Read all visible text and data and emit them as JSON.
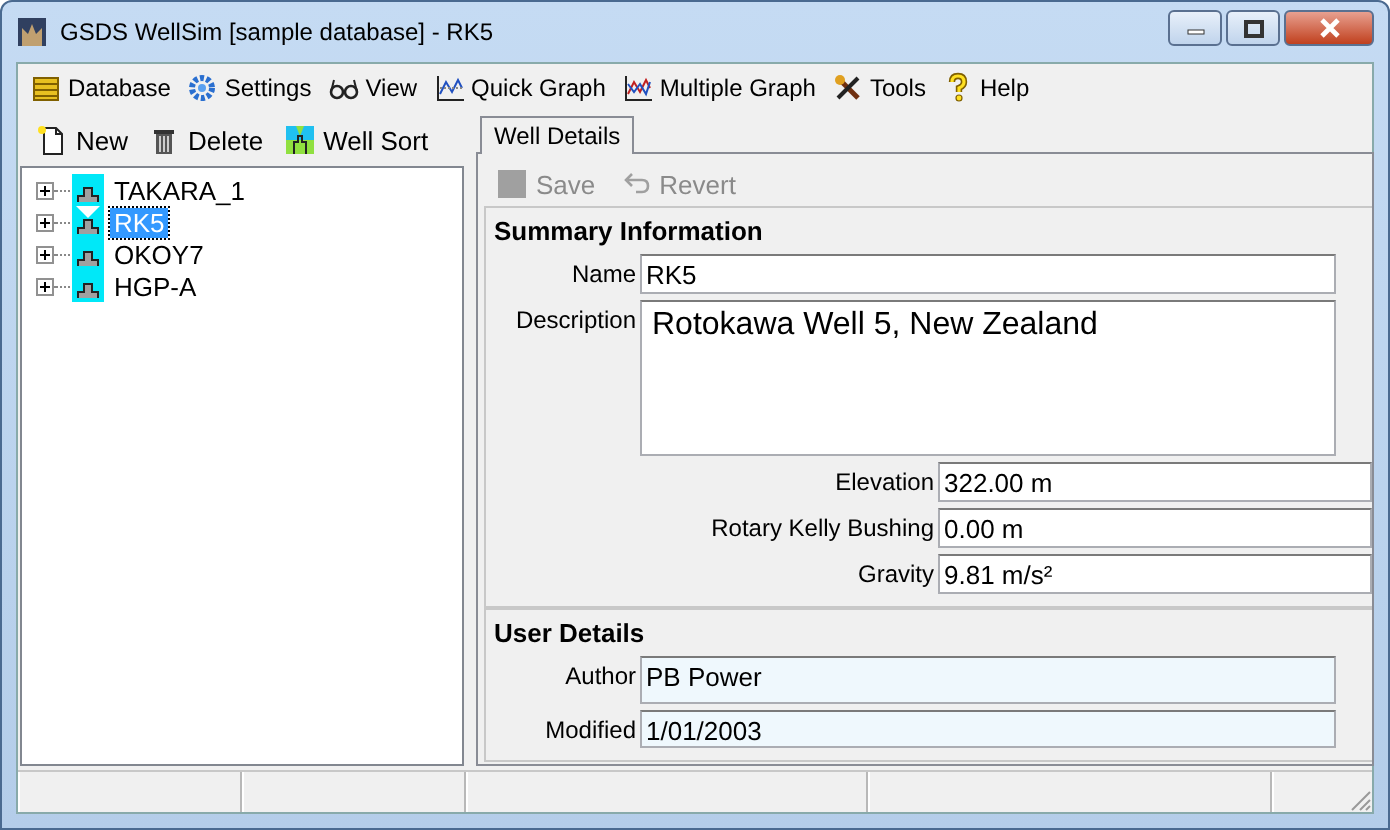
{
  "window": {
    "title": "GSDS WellSim [sample database] - RK5"
  },
  "menu": [
    {
      "label": "Database"
    },
    {
      "label": "Settings"
    },
    {
      "label": "View"
    },
    {
      "label": "Quick Graph"
    },
    {
      "label": "Multiple Graph"
    },
    {
      "label": "Tools"
    },
    {
      "label": "Help"
    }
  ],
  "well_toolbar": [
    {
      "label": "New"
    },
    {
      "label": "Delete"
    },
    {
      "label": "Well Sort"
    }
  ],
  "tree": [
    {
      "label": "TAKARA_1",
      "selected": false,
      "expanded": false
    },
    {
      "label": "RK5",
      "selected": true,
      "expanded": false
    },
    {
      "label": "OKOY7",
      "selected": false,
      "expanded": false
    },
    {
      "label": "HGP-A",
      "selected": false,
      "expanded": false
    }
  ],
  "tabs": [
    {
      "label": "Well Details",
      "selected": true
    }
  ],
  "detail_toolbar": [
    {
      "label": "Save",
      "disabled": true
    },
    {
      "label": "Revert",
      "disabled": true
    }
  ],
  "sections": [
    {
      "title": "Summary Information",
      "fields": [
        {
          "kind": "wide",
          "label": "Name",
          "value": "RK5",
          "readonly": false
        },
        {
          "kind": "multiline",
          "label": "Description",
          "value": "Rotokawa Well 5, New Zealand",
          "readonly": false
        },
        {
          "kind": "narrow",
          "label": "Elevation",
          "value": "322.00 m",
          "readonly": false
        },
        {
          "kind": "narrow",
          "label": "Rotary Kelly Bushing",
          "value": "0.00 m",
          "readonly": false
        },
        {
          "kind": "narrow",
          "label": "Gravity",
          "value": "9.81 m/s²",
          "readonly": false
        }
      ]
    },
    {
      "title": "User Details",
      "fields": [
        {
          "kind": "wide",
          "label": "Author",
          "value": "PB Power",
          "readonly": true
        },
        {
          "kind": "wide",
          "label": "Modified",
          "value": "1/01/2003",
          "readonly": true
        }
      ]
    }
  ]
}
